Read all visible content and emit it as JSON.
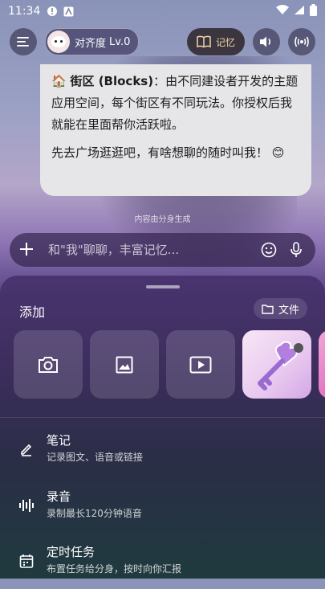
{
  "status_bar": {
    "time": "11:34"
  },
  "header": {
    "level_name": "对齐度",
    "level_value": "Lv.0",
    "memory_label": "记忆"
  },
  "chat": {
    "blocks_emoji": "🏠",
    "blocks_title": "街区 (Blocks)",
    "blocks_text": "：由不同建设者开发的主题应用空间，每个街区有不同玩法。你授权后我就能在里面帮你活跃啦。",
    "closing_text": "先去广场逛逛吧，有啥想聊的随时叫我！",
    "closing_emoji": "😊",
    "generated_note": "内容由分身生成"
  },
  "input": {
    "placeholder": "和\"我\"聊聊，丰富记忆..."
  },
  "sheet": {
    "title": "添加",
    "file_button": "文件",
    "items": [
      {
        "title": "笔记",
        "subtitle": "记录图文、语音或链接"
      },
      {
        "title": "录音",
        "subtitle": "录制最长120分钟语音"
      },
      {
        "title": "定时任务",
        "subtitle": "布置任务给分身，按时向你汇报"
      }
    ]
  },
  "colors": {
    "memory_text": "#f2d6a8",
    "bubble_bg": "#e6e6e8",
    "sheet_top": "#4a3470",
    "sheet_bottom": "#1f3a3e"
  }
}
